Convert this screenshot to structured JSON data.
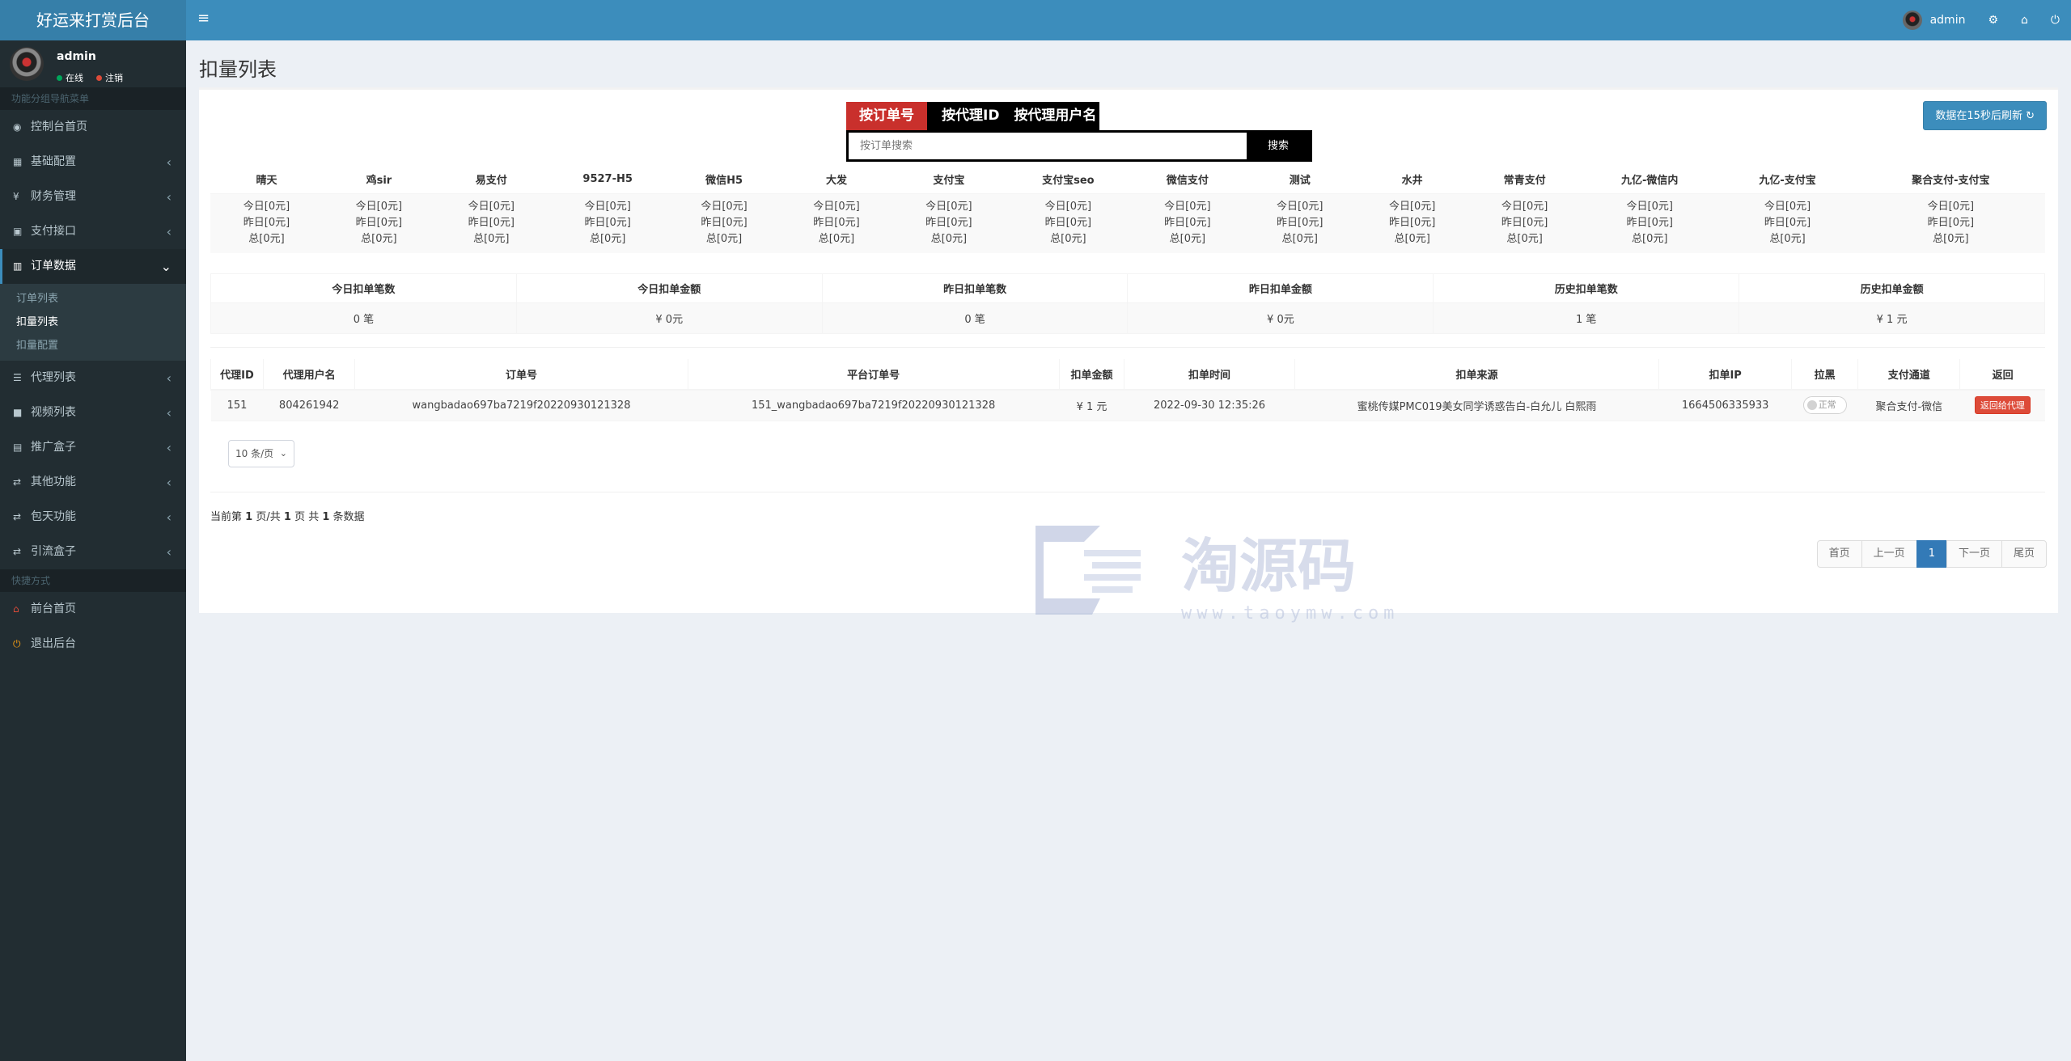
{
  "app": {
    "title": "好运来打赏后台"
  },
  "topbar": {
    "menu_icon": "bars-icon",
    "username": "admin"
  },
  "sidebar": {
    "user": {
      "name": "admin",
      "online": "在线",
      "logout": "注销"
    },
    "section1": "功能分组导航菜单",
    "items": [
      {
        "label": "控制台首页",
        "icon": "dashboard-icon"
      },
      {
        "label": "基础配置",
        "icon": "grid-icon"
      },
      {
        "label": "财务管理",
        "icon": "yen-icon"
      },
      {
        "label": "支付接口",
        "icon": "payment-icon"
      },
      {
        "label": "订单数据",
        "icon": "bar-chart-icon"
      },
      {
        "label": "代理列表",
        "icon": "users-icon"
      },
      {
        "label": "视频列表",
        "icon": "video-icon"
      },
      {
        "label": "推广盒子",
        "icon": "box-icon"
      },
      {
        "label": "其他功能",
        "icon": "retweet-icon"
      },
      {
        "label": "包天功能",
        "icon": "retweet-icon"
      },
      {
        "label": "引流盒子",
        "icon": "retweet-icon"
      }
    ],
    "submenu": [
      "订单列表",
      "扣量列表",
      "扣量配置"
    ],
    "section2": "快捷方式",
    "shortcuts": [
      {
        "label": "前台首页",
        "icon": "home-icon"
      },
      {
        "label": "退出后台",
        "icon": "power-icon"
      }
    ]
  },
  "page": {
    "title": "扣量列表"
  },
  "search": {
    "tabs": [
      "按订单号",
      "按代理ID",
      "按代理用户名"
    ],
    "placeholder": "按订单搜索",
    "button": "搜索"
  },
  "refresh_button": "数据在15秒后刷新",
  "channels": {
    "headers": [
      "晴天",
      "鸡sir",
      "易支付",
      "9527-H5",
      "微信H5",
      "大发",
      "支付宝",
      "支付宝seo",
      "微信支付",
      "测试",
      "水井",
      "常青支付",
      "九亿-微信内",
      "九亿-支付宝",
      "聚合支付-支付宝"
    ],
    "today": "今日[0元]",
    "yesterday": "昨日[0元]",
    "total": "总[0元]"
  },
  "stats": {
    "headers": [
      "今日扣单笔数",
      "今日扣单金额",
      "昨日扣单笔数",
      "昨日扣单金额",
      "历史扣单笔数",
      "历史扣单金额"
    ],
    "values": [
      "0 笔",
      "¥ 0元",
      "0 笔",
      "¥ 0元",
      "1 笔",
      "¥ 1 元"
    ]
  },
  "orders": {
    "headers": [
      "代理ID",
      "代理用户名",
      "订单号",
      "平台订单号",
      "扣单金额",
      "扣单时间",
      "扣单来源",
      "扣单IP",
      "拉黑",
      "支付通道",
      "返回"
    ],
    "rows": [
      {
        "agent_id": "151",
        "agent_name": "804261942",
        "order_no": "wangbadao697ba7219f20220930121328",
        "platform_no": "151_wangbadao697ba7219f20220930121328",
        "amount": "¥ 1 元",
        "time": "2022-09-30 12:35:26",
        "source": "蜜桃传媒PMC019美女同学诱惑告白-白允儿 白熙雨",
        "ip": "1664506335933",
        "blacklist": "正常",
        "channel": "聚合支付-微信",
        "action": "返回给代理"
      }
    ]
  },
  "pagination": {
    "page_size": "10 条/页",
    "info_prefix": "当前第",
    "current": "1",
    "info_mid": "页/共",
    "pages": "1",
    "info_mid2": "页 共",
    "count": "1",
    "info_suffix": "条数据",
    "first": "首页",
    "prev": "上一页",
    "next": "下一页",
    "last": "尾页"
  },
  "watermark": {
    "text": "淘源码",
    "url": "www.taoymw.com"
  }
}
